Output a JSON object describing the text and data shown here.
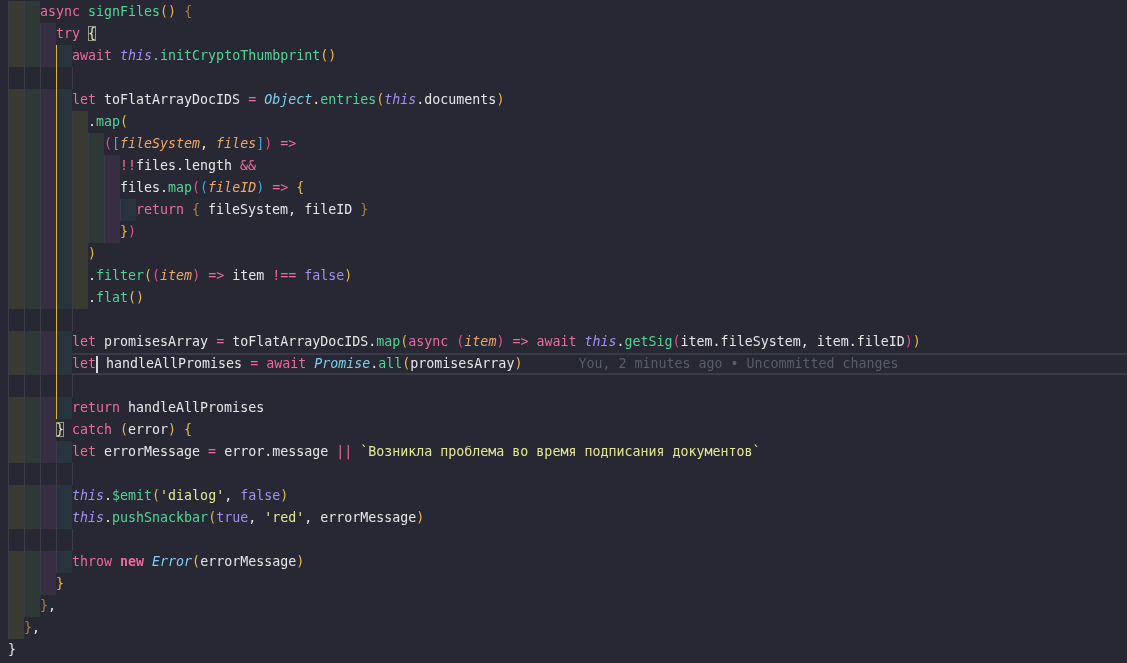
{
  "editor": {
    "lines": [
      {
        "current": false,
        "scope": false,
        "tokens": [
          {
            "text": "    async ",
            "kind": "kw"
          },
          {
            "text": "signFiles",
            "kind": "fn"
          },
          {
            "text": "() ",
            "kind": "b1"
          },
          {
            "text": "{",
            "kind": "brace"
          }
        ]
      },
      {
        "current": false,
        "scope": false,
        "tokens": [
          {
            "text": "      try ",
            "kind": "kw"
          },
          {
            "text": "{",
            "kind": "match"
          }
        ]
      },
      {
        "current": false,
        "scope": true,
        "tokens": [
          {
            "text": "        await ",
            "kind": "kw"
          },
          {
            "text": "this",
            "kind": "this"
          },
          {
            "text": ".initCryptoThumbprint",
            "kind": "fn"
          },
          {
            "text": "()",
            "kind": "b1"
          }
        ]
      },
      {
        "current": false,
        "scope": true
      },
      {
        "current": false,
        "scope": true,
        "tokens": [
          {
            "text": "        let",
            "kind": "kw"
          },
          {
            "text": " toFlatArrayDocIDS ",
            "kind": "plain"
          },
          {
            "text": "= ",
            "kind": "op"
          },
          {
            "text": "Object",
            "kind": "cls"
          },
          {
            "text": ".",
            "kind": "plain"
          },
          {
            "text": "entries",
            "kind": "fn"
          },
          {
            "text": "(",
            "kind": "b1"
          },
          {
            "text": "this",
            "kind": "this"
          },
          {
            "text": ".documents",
            "kind": "plain"
          },
          {
            "text": ")",
            "kind": "b1"
          }
        ]
      },
      {
        "current": false,
        "scope": true,
        "tokens": [
          {
            "text": "          .",
            "kind": "plain"
          },
          {
            "text": "map",
            "kind": "fn"
          },
          {
            "text": "(",
            "kind": "b1"
          }
        ]
      },
      {
        "current": false,
        "scope": true,
        "tokens": [
          {
            "text": "            (",
            "kind": "b2"
          },
          {
            "text": "[",
            "kind": "b3"
          },
          {
            "text": "fileSystem",
            "kind": "param"
          },
          {
            "text": ", ",
            "kind": "plain"
          },
          {
            "text": "files",
            "kind": "param"
          },
          {
            "text": "]",
            "kind": "b3"
          },
          {
            "text": ") ",
            "kind": "b2"
          },
          {
            "text": "=>",
            "kind": "op"
          }
        ]
      },
      {
        "current": false,
        "scope": true,
        "tokens": [
          {
            "text": "              !!",
            "kind": "op"
          },
          {
            "text": "files.length ",
            "kind": "plain"
          },
          {
            "text": "&&",
            "kind": "op"
          }
        ]
      },
      {
        "current": false,
        "scope": true,
        "tokens": [
          {
            "text": "              files.",
            "kind": "plain"
          },
          {
            "text": "map",
            "kind": "fn"
          },
          {
            "text": "(",
            "kind": "b2"
          },
          {
            "text": "(",
            "kind": "b3"
          },
          {
            "text": "fileID",
            "kind": "param"
          },
          {
            "text": ") ",
            "kind": "b3"
          },
          {
            "text": "=> ",
            "kind": "op"
          },
          {
            "text": "{",
            "kind": "b1"
          }
        ]
      },
      {
        "current": false,
        "scope": true,
        "tokens": [
          {
            "text": "                return ",
            "kind": "kw"
          },
          {
            "text": "{",
            "kind": "brace"
          },
          {
            "text": " fileSystem, fileID ",
            "kind": "plain"
          },
          {
            "text": "}",
            "kind": "brace"
          }
        ]
      },
      {
        "current": false,
        "scope": true,
        "tokens": [
          {
            "text": "              }",
            "kind": "b1"
          },
          {
            "text": ")",
            "kind": "b2"
          }
        ]
      },
      {
        "current": false,
        "scope": true,
        "tokens": [
          {
            "text": "          )",
            "kind": "b1"
          }
        ]
      },
      {
        "current": false,
        "scope": true,
        "tokens": [
          {
            "text": "          .",
            "kind": "plain"
          },
          {
            "text": "filter",
            "kind": "fn"
          },
          {
            "text": "(",
            "kind": "b1"
          },
          {
            "text": "(",
            "kind": "b2"
          },
          {
            "text": "item",
            "kind": "param"
          },
          {
            "text": ") ",
            "kind": "b2"
          },
          {
            "text": "=>",
            "kind": "op"
          },
          {
            "text": " item ",
            "kind": "plain"
          },
          {
            "text": "!== ",
            "kind": "op"
          },
          {
            "text": "false",
            "kind": "bool"
          },
          {
            "text": ")",
            "kind": "b1"
          }
        ]
      },
      {
        "current": false,
        "scope": true,
        "tokens": [
          {
            "text": "          .",
            "kind": "plain"
          },
          {
            "text": "flat",
            "kind": "fn"
          },
          {
            "text": "()",
            "kind": "b1"
          }
        ]
      },
      {
        "current": false,
        "scope": true
      },
      {
        "current": false,
        "scope": true,
        "tokens": [
          {
            "text": "        let",
            "kind": "kw"
          },
          {
            "text": " promisesArray ",
            "kind": "plain"
          },
          {
            "text": "=",
            "kind": "op"
          },
          {
            "text": " toFlatArrayDocIDS.",
            "kind": "plain"
          },
          {
            "text": "map",
            "kind": "fn"
          },
          {
            "text": "(",
            "kind": "b1"
          },
          {
            "text": "async ",
            "kind": "kw"
          },
          {
            "text": "(",
            "kind": "b2"
          },
          {
            "text": "item",
            "kind": "param"
          },
          {
            "text": ") ",
            "kind": "b2"
          },
          {
            "text": "=> ",
            "kind": "op"
          },
          {
            "text": "await ",
            "kind": "kw"
          },
          {
            "text": "this",
            "kind": "this"
          },
          {
            "text": ".",
            "kind": "plain"
          },
          {
            "text": "getSig",
            "kind": "fn"
          },
          {
            "text": "(",
            "kind": "b2"
          },
          {
            "text": "item.fileSystem, item.fileID",
            "kind": "plain"
          },
          {
            "text": ")",
            "kind": "b2"
          },
          {
            "text": ")",
            "kind": "b1"
          }
        ]
      },
      {
        "current": true,
        "scope": true,
        "blame": "You, 2 minutes ago • Uncommitted changes",
        "tokens": [
          {
            "text": "        let",
            "kind": "kw",
            "cursor": true
          },
          {
            "text": " handleAllPromises ",
            "kind": "plain"
          },
          {
            "text": "= ",
            "kind": "op"
          },
          {
            "text": "await ",
            "kind": "kw"
          },
          {
            "text": "Promise",
            "kind": "cls"
          },
          {
            "text": ".",
            "kind": "plain"
          },
          {
            "text": "all",
            "kind": "fn"
          },
          {
            "text": "(",
            "kind": "b1"
          },
          {
            "text": "promisesArray",
            "kind": "plain"
          },
          {
            "text": ")",
            "kind": "b1"
          }
        ]
      },
      {
        "current": false,
        "scope": true
      },
      {
        "current": false,
        "scope": true,
        "tokens": [
          {
            "text": "        return",
            "kind": "kw"
          },
          {
            "text": " handleAllPromises",
            "kind": "plain"
          }
        ]
      },
      {
        "current": false,
        "scope": false,
        "tokens": [
          {
            "text": "      }",
            "kind": "match"
          },
          {
            "text": " catch ",
            "kind": "kw"
          },
          {
            "text": "(",
            "kind": "b1"
          },
          {
            "text": "error",
            "kind": "plain"
          },
          {
            "text": ") {",
            "kind": "b1"
          }
        ]
      },
      {
        "current": false,
        "scope": false,
        "tokens": [
          {
            "text": "        let",
            "kind": "kw"
          },
          {
            "text": " errorMessage ",
            "kind": "plain"
          },
          {
            "text": "=",
            "kind": "op"
          },
          {
            "text": " error.message ",
            "kind": "plain"
          },
          {
            "text": "|| ",
            "kind": "op"
          },
          {
            "text": "`Возникла проблема во время подписания документов`",
            "kind": "str"
          }
        ]
      },
      {
        "current": false,
        "scope": false
      },
      {
        "current": false,
        "scope": false,
        "tokens": [
          {
            "text": "        this",
            "kind": "this"
          },
          {
            "text": ".",
            "kind": "plain"
          },
          {
            "text": "$emit",
            "kind": "fn"
          },
          {
            "text": "(",
            "kind": "b1"
          },
          {
            "text": "'dialog'",
            "kind": "str"
          },
          {
            "text": ", ",
            "kind": "plain"
          },
          {
            "text": "false",
            "kind": "bool"
          },
          {
            "text": ")",
            "kind": "b1"
          }
        ]
      },
      {
        "current": false,
        "scope": false,
        "tokens": [
          {
            "text": "        this",
            "kind": "this"
          },
          {
            "text": ".",
            "kind": "plain"
          },
          {
            "text": "pushSnackbar",
            "kind": "fn"
          },
          {
            "text": "(",
            "kind": "b1"
          },
          {
            "text": "true",
            "kind": "bool"
          },
          {
            "text": ", ",
            "kind": "plain"
          },
          {
            "text": "'red'",
            "kind": "str"
          },
          {
            "text": ", errorMessage",
            "kind": "plain"
          },
          {
            "text": ")",
            "kind": "b1"
          }
        ]
      },
      {
        "current": false,
        "scope": false
      },
      {
        "current": false,
        "scope": false,
        "tokens": [
          {
            "text": "        throw ",
            "kind": "kw"
          },
          {
            "text": "new ",
            "kind": "kwb"
          },
          {
            "text": "Error",
            "kind": "cls"
          },
          {
            "text": "(",
            "kind": "b1"
          },
          {
            "text": "errorMessage",
            "kind": "plain"
          },
          {
            "text": ")",
            "kind": "b1"
          }
        ]
      },
      {
        "current": false,
        "scope": false,
        "tokens": [
          {
            "text": "      }",
            "kind": "b1"
          }
        ]
      },
      {
        "current": false,
        "scope": false,
        "tokens": [
          {
            "text": "    }",
            "kind": "brace"
          },
          {
            "text": ",",
            "kind": "plain"
          }
        ]
      },
      {
        "current": false,
        "scope": false,
        "tokens": [
          {
            "text": "  }",
            "kind": "brace"
          },
          {
            "text": ",",
            "kind": "plain"
          }
        ]
      },
      {
        "current": false,
        "scope": false,
        "tokens": [
          {
            "text": "}",
            "kind": "plain"
          }
        ]
      }
    ]
  }
}
